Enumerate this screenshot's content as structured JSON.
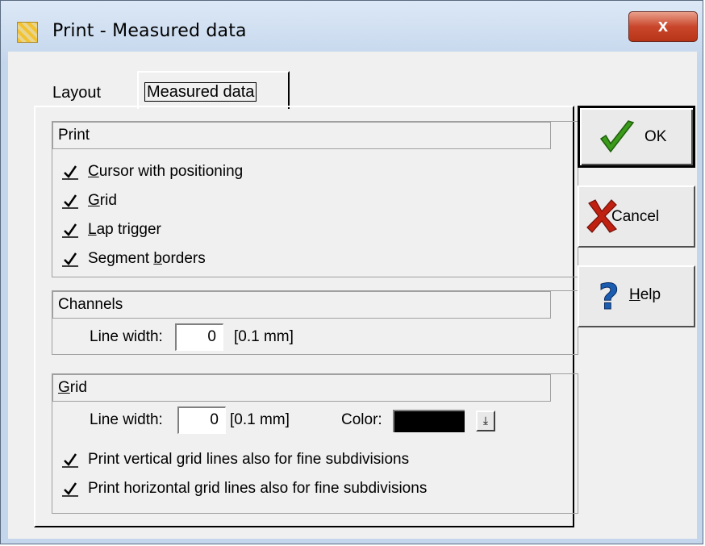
{
  "window": {
    "title": "Print - Measured data",
    "close_label": "x",
    "app_icon": "print-app-icon"
  },
  "tabs": [
    {
      "label": "Layout",
      "active": false
    },
    {
      "label": "Measured data",
      "active": true
    }
  ],
  "print_group": {
    "header": "Print",
    "options": [
      {
        "prefix": "",
        "mnemonic": "C",
        "suffix": "ursor with positioning",
        "checked": true
      },
      {
        "prefix": "",
        "mnemonic": "G",
        "suffix": "rid",
        "checked": true
      },
      {
        "prefix": "",
        "mnemonic": "L",
        "suffix": "ap trigger",
        "checked": true
      },
      {
        "prefix": "Segment ",
        "mnemonic": "b",
        "suffix": "orders",
        "checked": true
      }
    ]
  },
  "channels_group": {
    "header": "Channels",
    "line_width_label": "Line width:",
    "line_width_value": "0",
    "unit": "[0.1 mm]"
  },
  "grid_group": {
    "header_mnemonic": "G",
    "header_rest": "rid",
    "line_width_label": "Line width:",
    "line_width_value": "0",
    "unit": "[0.1 mm]",
    "color_label": "Color:",
    "color_value": "#000000",
    "options": [
      {
        "label": "Print vertical grid lines also for fine subdivisions",
        "checked": true
      },
      {
        "label": "Print horizontal grid lines also for fine subdivisions",
        "checked": true
      }
    ]
  },
  "buttons": {
    "ok": "OK",
    "cancel": "Cancel",
    "help_mnemonic": "H",
    "help_rest": "elp"
  },
  "colors": {
    "ok_check": "#3a9a1a",
    "cancel_x": "#c02010",
    "help_question": "#1a5cb0"
  }
}
